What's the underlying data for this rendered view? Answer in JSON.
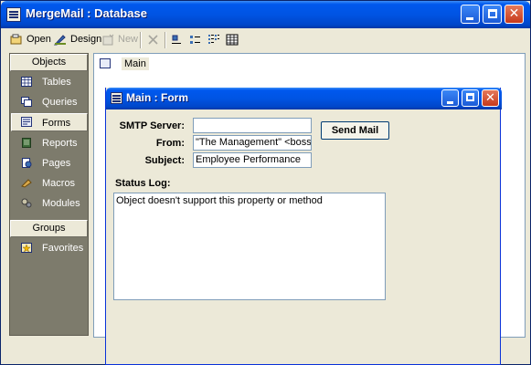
{
  "db_window": {
    "title": "MergeMail : Database",
    "toolbar": {
      "open": "Open",
      "design": "Design",
      "new": "New"
    },
    "objects_header": "Objects",
    "objects": [
      {
        "label": "Tables",
        "icon": "table-icon"
      },
      {
        "label": "Queries",
        "icon": "query-icon"
      },
      {
        "label": "Forms",
        "icon": "form-icon",
        "selected": true
      },
      {
        "label": "Reports",
        "icon": "report-icon"
      },
      {
        "label": "Pages",
        "icon": "page-icon"
      },
      {
        "label": "Macros",
        "icon": "macro-icon"
      },
      {
        "label": "Modules",
        "icon": "module-icon"
      }
    ],
    "groups_header": "Groups",
    "groups": [
      {
        "label": "Favorites",
        "icon": "favorites-icon"
      }
    ],
    "list_items": [
      "Main"
    ]
  },
  "form_window": {
    "title": "Main : Form",
    "smtp_label": "SMTP Server:",
    "smtp_value": "",
    "from_label": "From:",
    "from_value": "\"The Management\" <boss@c",
    "subject_label": "Subject:",
    "subject_value": "Employee Performance",
    "send_button": "Send Mail",
    "status_label": "Status Log:",
    "status_text": "Object doesn't support this property or method"
  }
}
